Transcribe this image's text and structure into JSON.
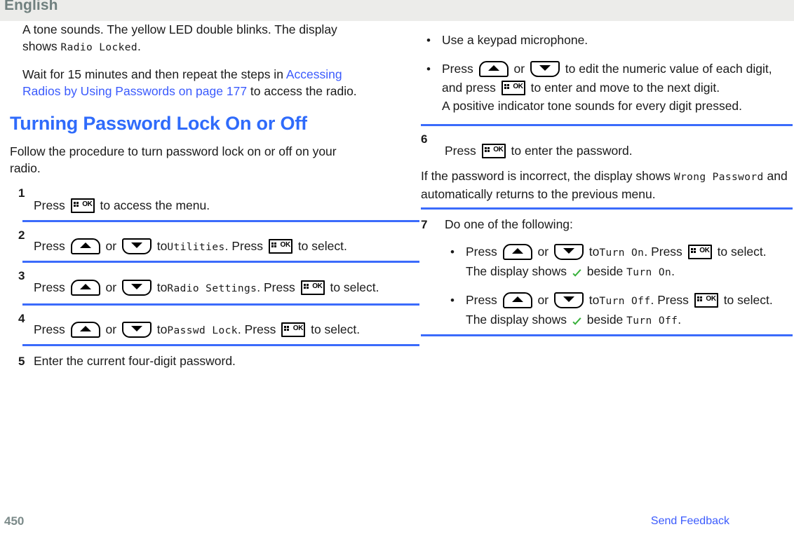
{
  "header": {
    "language": "English"
  },
  "colors": {
    "link": "#3b5bfd",
    "heading": "#2f6bfb",
    "separator": "#3b6bfb",
    "header_band": "#ececea",
    "footer_page": "#7b8a89",
    "check": "#37b03a"
  },
  "left_column": {
    "intro_paragraph_1": {
      "text_before": "A tone sounds. The yellow LED double blinks. The display shows ",
      "mono": "Radio Locked",
      "text_after": "."
    },
    "intro_paragraph_2": {
      "text_before": "Wait for 15 minutes and then repeat the steps in ",
      "link": "Accessing Radios by Using Passwords on page 177",
      "text_after": " to access the radio."
    },
    "section_title": "Turning Password Lock On or Off",
    "section_intro": "Follow the procedure to turn password lock on or off on your radio.",
    "steps": [
      {
        "number": "1",
        "press_label": "Press",
        "key": "ok-key",
        "tail": "to access the menu."
      },
      {
        "number": "2",
        "press_label": "Press",
        "or_label": "or",
        "to_label": "to",
        "menu_item": "Utilities",
        "period": ".",
        "press_label_2": "Press",
        "tail": "to select."
      },
      {
        "number": "3",
        "press_label": "Press",
        "or_label": "or",
        "to_label": "to",
        "menu_item": "Radio Settings",
        "period": ".",
        "press_label_2": "Press",
        "tail": "to select."
      },
      {
        "number": "4",
        "press_label": "Press",
        "or_label": "or",
        "to_label": "to",
        "menu_item": "Passwd Lock",
        "period": ".",
        "press_label_2": "Press",
        "tail": "to select."
      },
      {
        "number": "5",
        "text": "Enter the current four-digit password."
      }
    ]
  },
  "right_column": {
    "bullets_top": [
      {
        "text": "Use a keypad microphone."
      },
      {
        "press_label": "Press",
        "or_label": "or",
        "mid_text": "to edit the numeric value of each digit, and press",
        "tail": "to enter and move to the next digit.",
        "sub_line": "A positive indicator tone sounds for every digit pressed."
      }
    ],
    "steps": [
      {
        "number": "6",
        "press_label": "Press",
        "tail": "to enter the password.",
        "note_before": "If the password is incorrect, the display shows ",
        "note_mono": "Wrong Password",
        "note_after": " and automatically returns to the previous menu."
      },
      {
        "number": "7",
        "text": "Do one of the following:",
        "bullets": [
          {
            "press_label": "Press",
            "or_label": "or",
            "to_label": "to",
            "menu_item": "Turn On",
            "period": ".",
            "press_label_2": "Press",
            "tail": "to select.",
            "result_before": "The display shows",
            "result_after": "beside",
            "result_mono": "Turn On",
            "result_period": "."
          },
          {
            "press_label": "Press",
            "or_label": "or",
            "to_label": "to",
            "menu_item": "Turn Off",
            "period": ".",
            "press_label_2": "Press",
            "tail": "to select.",
            "result_before": "The display shows",
            "result_after": "beside",
            "result_mono": "Turn Off",
            "result_period": "."
          }
        ]
      }
    ]
  },
  "footer": {
    "page_number": "450",
    "feedback_link": "Send Feedback"
  }
}
